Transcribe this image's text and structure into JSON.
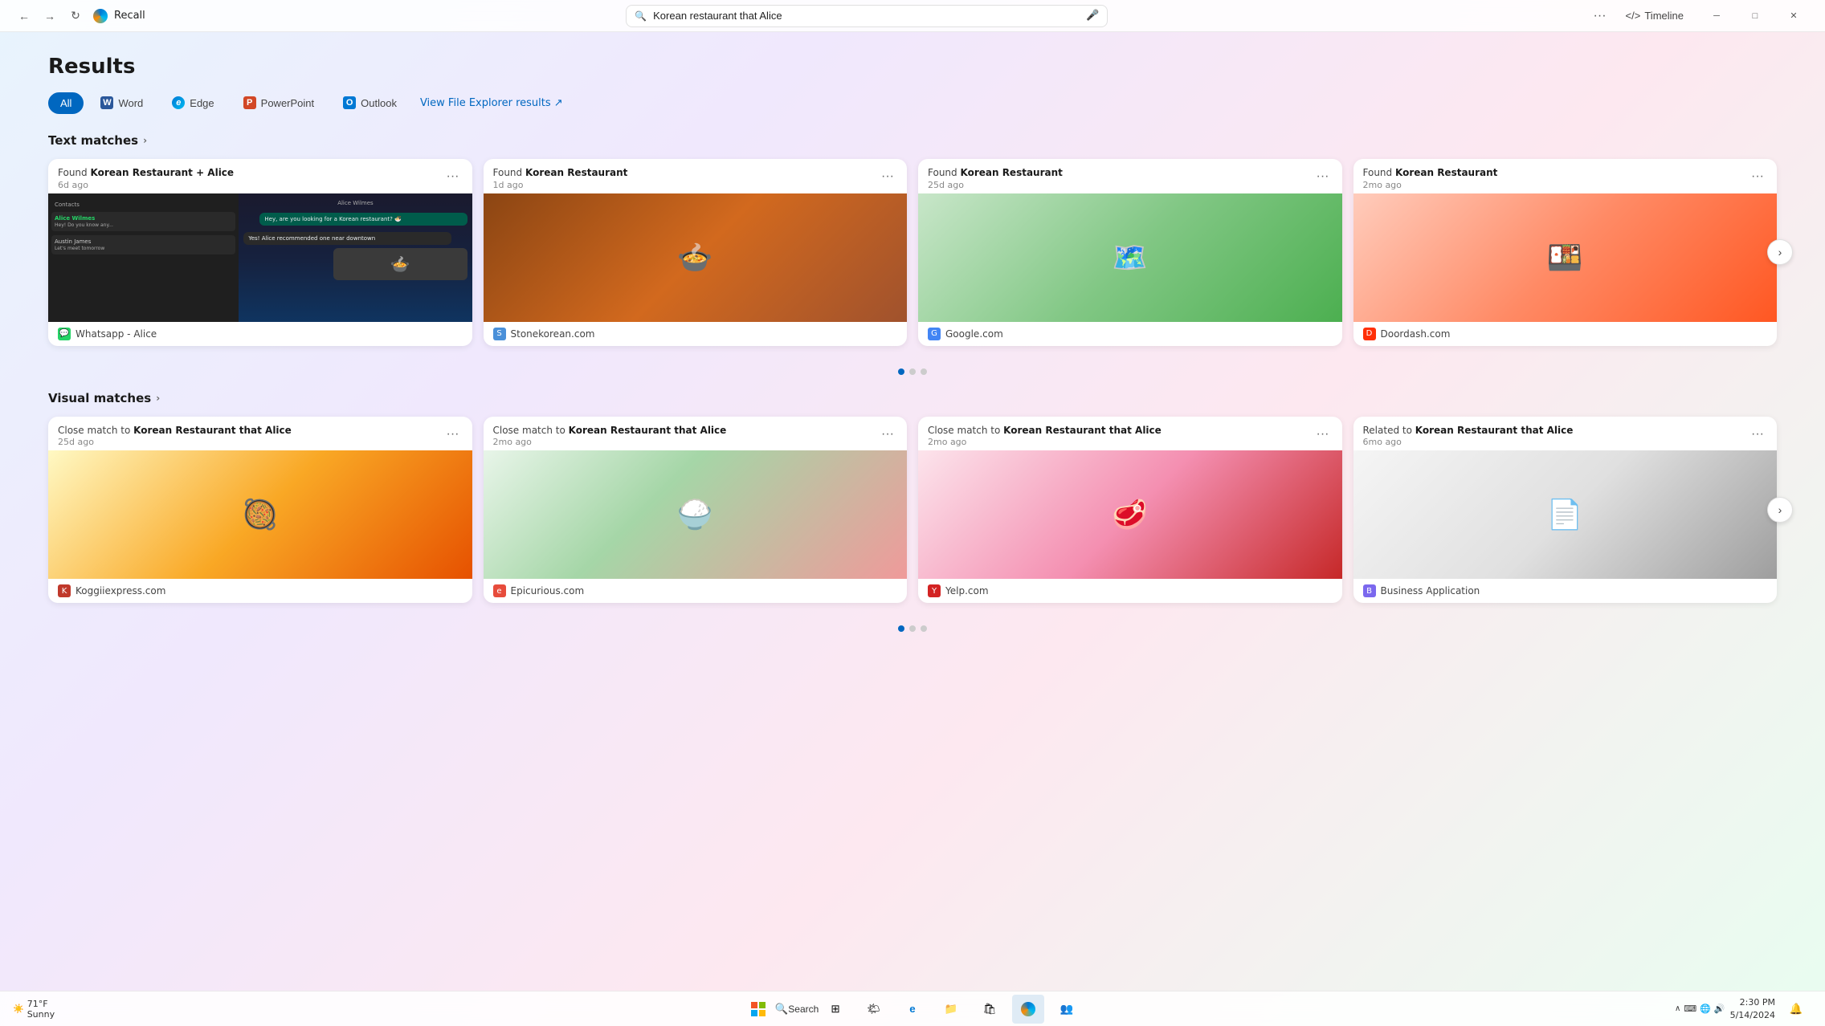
{
  "app": {
    "title": "Recall",
    "search_query": "Korean restaurant that Alice"
  },
  "titlebar": {
    "back_label": "←",
    "forward_label": "→",
    "refresh_label": "↻",
    "more_label": "···",
    "timeline_label": "Timeline",
    "minimize_label": "─",
    "maximize_label": "□",
    "close_label": "✕"
  },
  "results": {
    "title": "Results",
    "filter_tabs": [
      {
        "id": "all",
        "label": "All",
        "active": true,
        "icon": ""
      },
      {
        "id": "word",
        "label": "Word",
        "active": false,
        "icon": "W"
      },
      {
        "id": "edge",
        "label": "Edge",
        "active": false,
        "icon": "e"
      },
      {
        "id": "powerpoint",
        "label": "PowerPoint",
        "active": false,
        "icon": "P"
      },
      {
        "id": "outlook",
        "label": "Outlook",
        "active": false,
        "icon": "O"
      }
    ],
    "view_file_explorer_label": "View File Explorer results ↗"
  },
  "text_matches": {
    "section_label": "Text matches",
    "cards": [
      {
        "found_prefix": "Found",
        "found_text": "Korean Restaurant + Alice",
        "time": "6d ago",
        "source": "Whatsapp - Alice",
        "source_color": "#25D366",
        "img_emoji": "💬"
      },
      {
        "found_prefix": "Found",
        "found_text": "Korean Restaurant",
        "time": "1d ago",
        "source": "Stonekorean.com",
        "source_color": "#4a90d9",
        "img_emoji": "🍲"
      },
      {
        "found_prefix": "Found",
        "found_text": "Korean Restaurant",
        "time": "25d ago",
        "source": "Google.com",
        "source_color": "#4285F4",
        "img_emoji": "🗺️"
      },
      {
        "found_prefix": "Found",
        "found_text": "Korean Restaurant",
        "time": "2mo ago",
        "source": "Doordash.com",
        "source_color": "#FF3008",
        "img_emoji": "🍱"
      }
    ]
  },
  "visual_matches": {
    "section_label": "Visual matches",
    "cards": [
      {
        "match_prefix": "Close match to",
        "match_text": "Korean Restaurant that Alice",
        "time": "25d ago",
        "source": "Koggiiexpress.com",
        "source_color": "#c0392b",
        "img_emoji": "🥘"
      },
      {
        "match_prefix": "Close match to",
        "match_text": "Korean Restaurant that Alice",
        "time": "2mo ago",
        "source": "Epicurious.com",
        "source_color": "#e74c3c",
        "img_emoji": "🍚"
      },
      {
        "match_prefix": "Close match to",
        "match_text": "Korean Restaurant that Alice",
        "time": "2mo ago",
        "source": "Yelp.com",
        "source_color": "#d32323",
        "img_emoji": "🥩"
      },
      {
        "match_prefix": "Related to",
        "match_text": "Korean Restaurant that Alice",
        "time": "6mo ago",
        "source": "Business Application",
        "source_color": "#7B68EE",
        "img_emoji": "📄"
      }
    ]
  },
  "pagination": {
    "dots": [
      {
        "active": true
      },
      {
        "active": false
      },
      {
        "active": false
      }
    ]
  },
  "taskbar": {
    "weather_temp": "71°F",
    "weather_condition": "Sunny",
    "time": "2:30 PM",
    "date": "5/14/2024",
    "search_label": "Search"
  }
}
